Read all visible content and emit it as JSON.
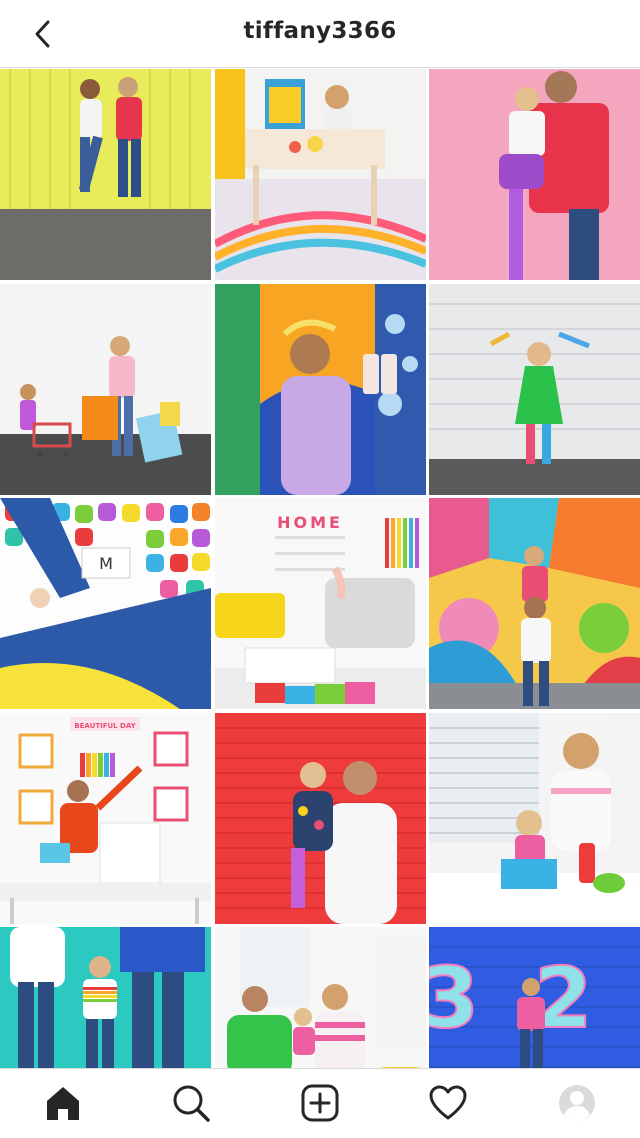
{
  "header": {
    "username": "tiffany3366",
    "back_icon": "chevron-left-icon"
  },
  "posts": [
    {
      "row": 1,
      "col": 1,
      "type": "photo"
    },
    {
      "row": 1,
      "col": 2,
      "type": "photo"
    },
    {
      "row": 1,
      "col": 3,
      "type": "photo"
    },
    {
      "row": 2,
      "col": 1,
      "type": "photo"
    },
    {
      "row": 2,
      "col": 2,
      "type": "photo"
    },
    {
      "row": 2,
      "col": 3,
      "type": "photo"
    },
    {
      "row": 3,
      "col": 1,
      "type": "photo",
      "sign_text": "M"
    },
    {
      "row": 3,
      "col": 2,
      "type": "photo",
      "wall_text": "HOME"
    },
    {
      "row": 3,
      "col": 3,
      "type": "photo"
    },
    {
      "row": 4,
      "col": 1,
      "type": "photo",
      "banner_text": "BEAUTIFUL DAY"
    },
    {
      "row": 4,
      "col": 2,
      "type": "photo"
    },
    {
      "row": 4,
      "col": 3,
      "type": "photo"
    },
    {
      "row": 5,
      "col": 1,
      "type": "photo"
    },
    {
      "row": 5,
      "col": 2,
      "type": "photo"
    },
    {
      "row": 5,
      "col": 3,
      "type": "photo",
      "balloon_text": "32"
    }
  ],
  "bottom_nav": {
    "items": [
      "home-icon",
      "search-icon",
      "new-post-icon",
      "activity-heart-icon",
      "profile-avatar-icon"
    ],
    "active": "home-icon"
  },
  "colors": {
    "text": "#262626",
    "divider": "#dbdbdb",
    "background": "#ffffff"
  }
}
